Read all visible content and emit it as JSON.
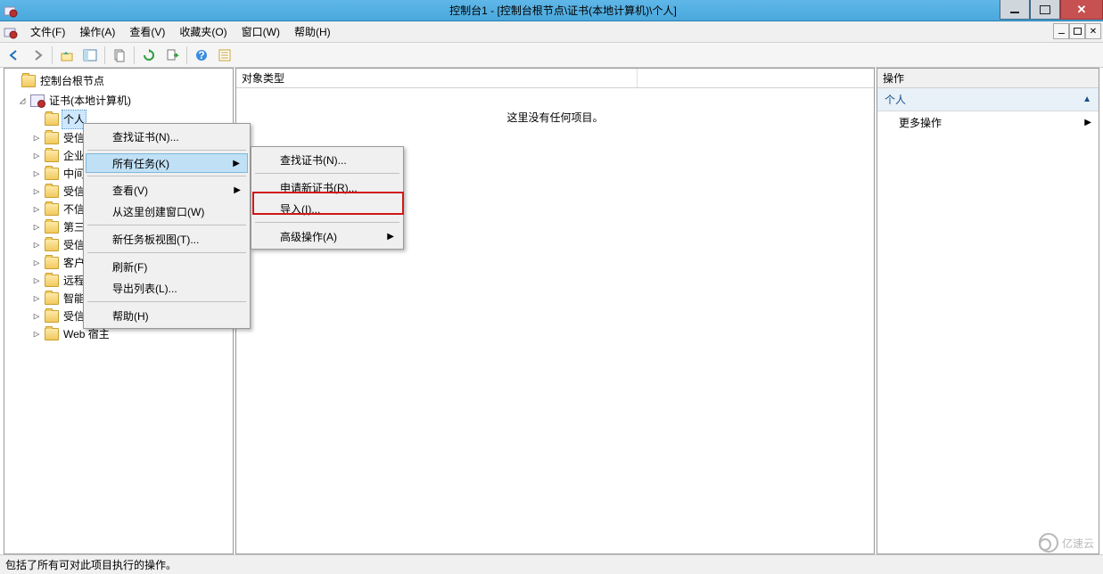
{
  "window": {
    "title": "控制台1 - [控制台根节点\\证书(本地计算机)\\个人]"
  },
  "menubar": {
    "items": [
      "文件(F)",
      "操作(A)",
      "查看(V)",
      "收藏夹(O)",
      "窗口(W)",
      "帮助(H)"
    ]
  },
  "tree": {
    "root": "控制台根节点",
    "cert_root": "证书(本地计算机)",
    "nodes": [
      {
        "label": "个人",
        "selected": true
      },
      {
        "label": "受信"
      },
      {
        "label": "企业"
      },
      {
        "label": "中间"
      },
      {
        "label": "受信"
      },
      {
        "label": "不信"
      },
      {
        "label": "第三"
      },
      {
        "label": "受信"
      },
      {
        "label": "客户"
      },
      {
        "label": "远程"
      },
      {
        "label": "智能卡受信任的根"
      },
      {
        "label": "受信任的设备"
      },
      {
        "label": "Web 宿主"
      }
    ]
  },
  "center": {
    "column": "对象类型",
    "empty": "这里没有任何项目。"
  },
  "actions": {
    "header": "操作",
    "section": "个人",
    "more": "更多操作"
  },
  "status": "包括了所有可对此项目执行的操作。",
  "context1": {
    "find": "查找证书(N)...",
    "all_tasks": "所有任务(K)",
    "view": "查看(V)",
    "new_window": "从这里创建窗口(W)",
    "new_taskpad": "新任务板视图(T)...",
    "refresh": "刷新(F)",
    "export": "导出列表(L)...",
    "help": "帮助(H)"
  },
  "context2": {
    "find": "查找证书(N)...",
    "request": "申请新证书(R)...",
    "import": "导入(I)...",
    "advanced": "高级操作(A)"
  },
  "watermark": "亿速云"
}
